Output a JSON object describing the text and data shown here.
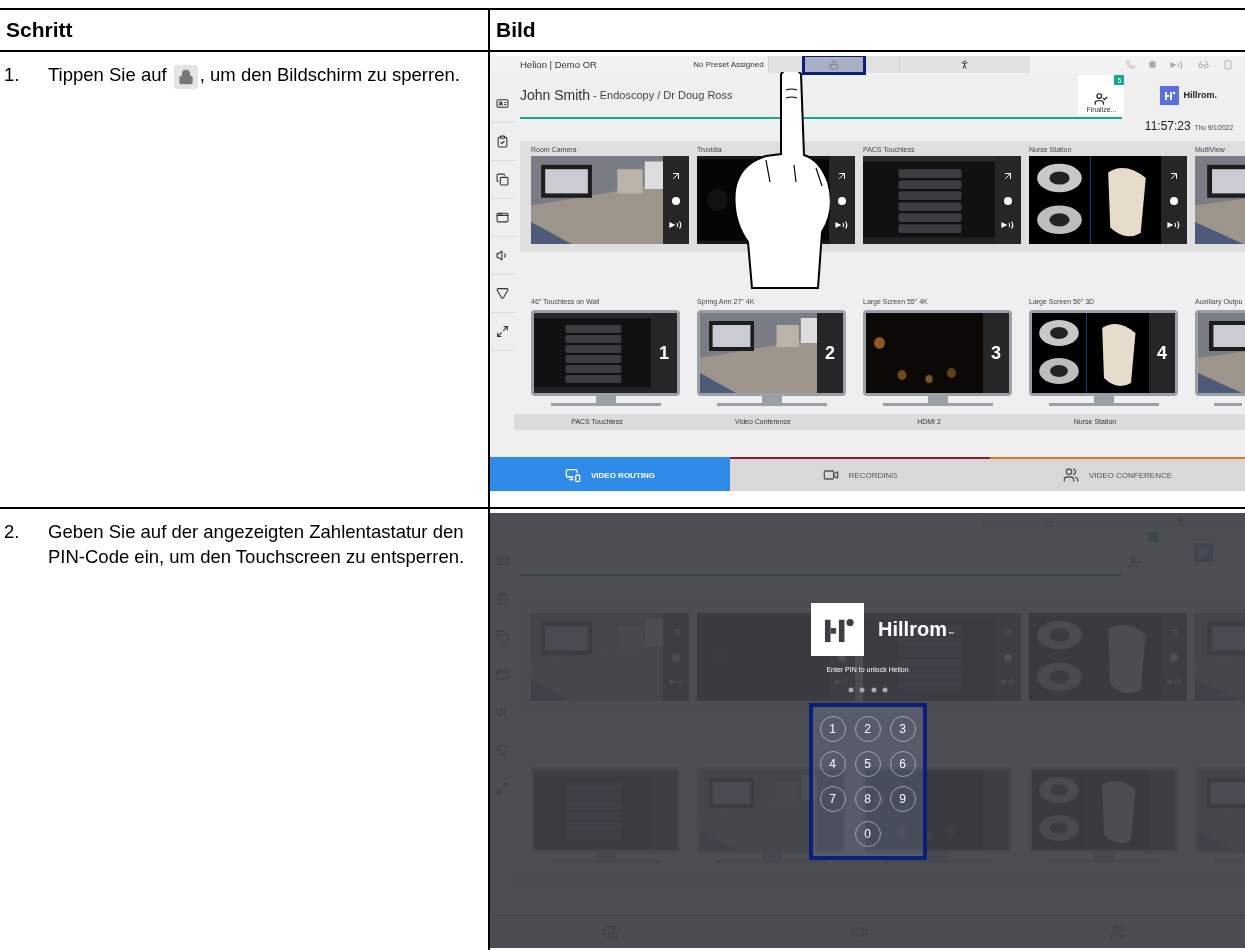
{
  "table": {
    "columns": [
      "Schritt",
      "Bild"
    ]
  },
  "steps": [
    {
      "number": "1.",
      "text_before": "Tippen Sie auf",
      "text_after": ", um den Bildschirm zu sperren.",
      "screen": {
        "room": "Helion | Demo OR",
        "preset": "No Preset Assigned",
        "lock_highlighted": true,
        "touch_gesture": true,
        "patient_name": "John Smith",
        "procedure": "- Endoscopy / Dr Doug Ross",
        "finalize_label": "Finalize...",
        "badge": "5",
        "brand": "Hillrom.",
        "time": "11:57:23",
        "date": "Thu 9/1/2022",
        "sources": [
          "Room Camera",
          "Truvidia",
          "PACS Touchless",
          "Nurse Station",
          "MultiView"
        ],
        "displays": [
          {
            "label": "46\" Touchless on Wall",
            "number": "1"
          },
          {
            "label": "Spring Arm 27\" 4K",
            "number": "2"
          },
          {
            "label": "Large Screen 55\" 4K",
            "number": "3"
          },
          {
            "label": "Large Screen 50\" 3D",
            "number": "4"
          },
          {
            "label": "Auxiliary Outpu"
          }
        ],
        "routes": [
          "PACS Touchless",
          "Video Conference",
          "HDMI 2",
          "Nurse Station"
        ],
        "tabs": [
          {
            "label": "VIDEO ROUTING",
            "selected": true,
            "color": "#2f8bea"
          },
          {
            "label": "RECORDING",
            "selected": false,
            "color": "#8b1d2c"
          },
          {
            "label": "VIDEO CONFERENCE",
            "selected": false,
            "color": "#e07a1f"
          }
        ]
      }
    },
    {
      "number": "2.",
      "text": "Geben Sie auf der angezeigten Zahlentastatur den PIN-Code ein, um den Touchscreen zu entsperren.",
      "screen": {
        "lock_screen": {
          "brand": "Hillrom",
          "trademark": "™",
          "prompt": "Enter PIN to unlock Helion",
          "keypad_highlighted": true,
          "keys": [
            "1",
            "2",
            "3",
            "4",
            "5",
            "6",
            "7",
            "8",
            "9",
            "0"
          ]
        }
      }
    }
  ]
}
